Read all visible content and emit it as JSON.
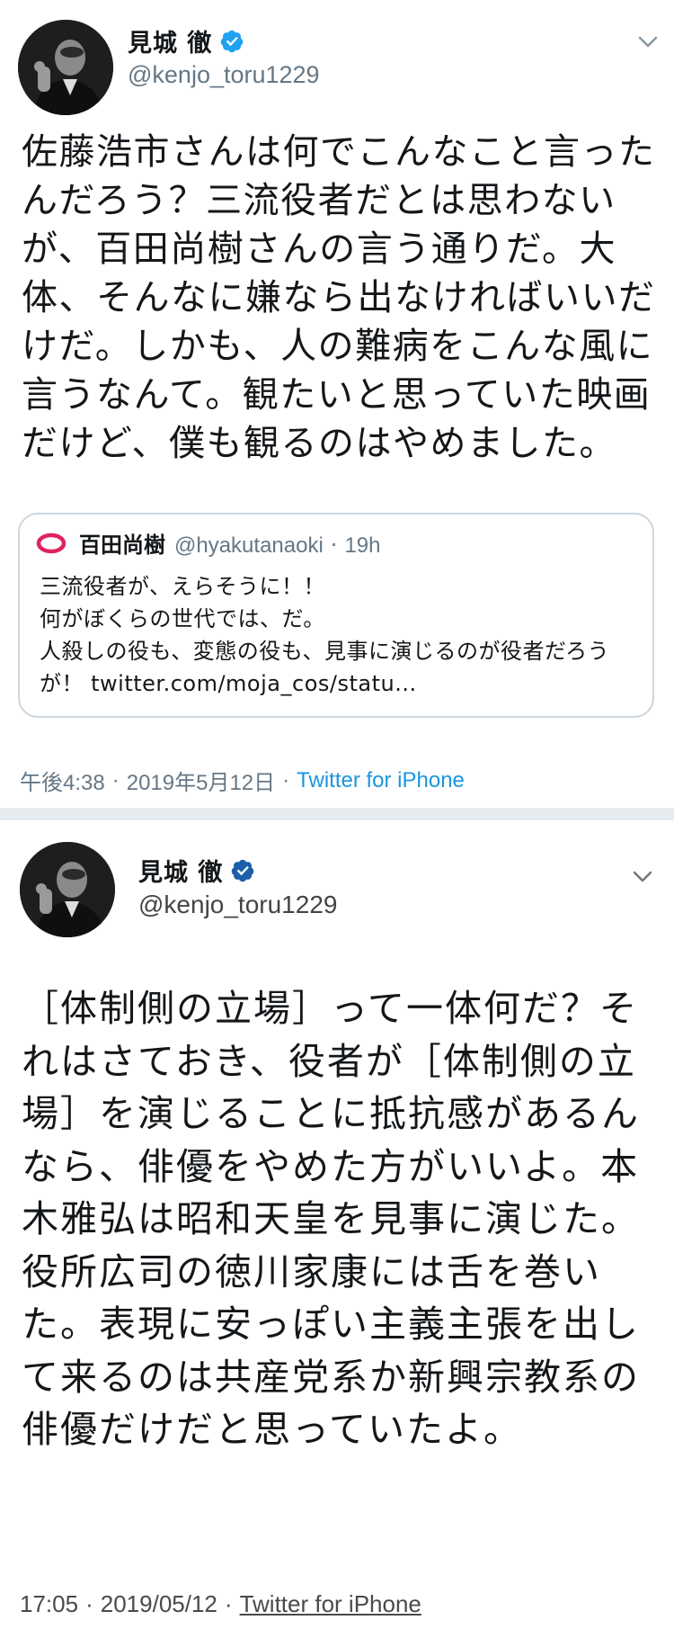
{
  "tweets": [
    {
      "author": {
        "display_name": "見城 徹",
        "handle": "@kenjo_toru1229",
        "verified": true
      },
      "text": "佐藤浩市さんは何でこんなこと言ったんだろう？三流役者だとは思わないが、百田尚樹さんの言う通りだ。大体、そんなに嫌なら出なければいいだけだ。しかも、人の難病をこんな風に言うなんて。観たいと思っていた映画だけど、僕も観るのはやめました。",
      "quote": {
        "display_name": "百田尚樹",
        "handle": "@hyakutanaoki",
        "separator": "·",
        "time": "19h",
        "text": "三流役者が、えらそうに！！\n何がぼくらの世代では、だ。\n人殺しの役も、変態の役も、見事に演じるのが役者だろうが！ twitter.com/moja_cos/statu..."
      },
      "meta": {
        "time": "午後4:38",
        "sep": "·",
        "date": "2019年5月12日",
        "sep2": "·",
        "source": "Twitter for iPhone"
      }
    },
    {
      "author": {
        "display_name": "見城 徹",
        "handle": "@kenjo_toru1229",
        "verified": true
      },
      "text": "［体制側の立場］って一体何だ？それはさておき、役者が［体制側の立場］を演じることに抵抗感があるんなら、俳優をやめた方がいいよ。本木雅弘は昭和天皇を見事に演じた。役所広司の徳川家康には舌を巻いた。表現に安っぽい主義主張を出して来るのは共産党系か新興宗教系の俳優だけだと思っていたよ。",
      "meta": {
        "time": "17:05",
        "sep": "·",
        "date": "2019/05/12",
        "sep2": "·",
        "source": "Twitter for iPhone"
      }
    }
  ],
  "colors": {
    "verified": "#1da1f2",
    "secondary_text": "#657786",
    "link": "#1b95e0",
    "divider": "#e6ecf0",
    "border": "#cdd6dd"
  },
  "icons": {
    "verified": "verified-badge-icon",
    "menu": "chevron-down-icon",
    "quote_avatar": "quote-avatar-icon"
  }
}
